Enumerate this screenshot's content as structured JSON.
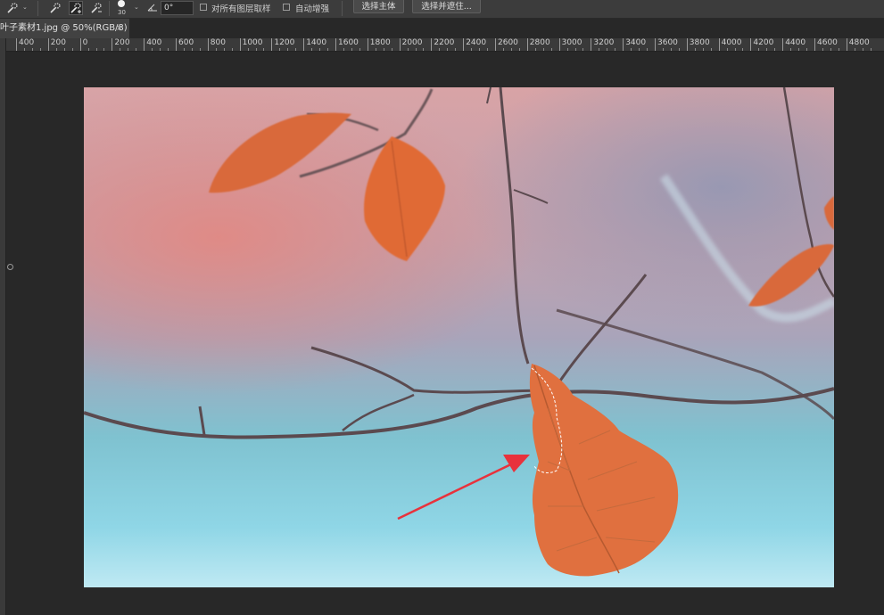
{
  "options_bar": {
    "brush_size": "30",
    "angle_value": "0°",
    "sample_all_layers_label": "对所有图层取样",
    "auto_enhance_label": "自动增强",
    "select_subject_label": "选择主体",
    "select_and_mask_label": "选择并遮住..."
  },
  "document_tab": {
    "title": "叶子素材1.jpg @ 50%(RGB/8)",
    "close": "×"
  },
  "ruler": {
    "labels": [
      "400",
      "200",
      "0",
      "200",
      "400",
      "600",
      "800",
      "1000",
      "1200",
      "1400",
      "1600",
      "1800",
      "2000",
      "2200",
      "2400",
      "2600",
      "2800",
      "3000",
      "3200",
      "3400",
      "3600",
      "3800",
      "4000",
      "4200",
      "4400",
      "4600",
      "4800"
    ]
  },
  "colors": {
    "annotation_arrow": "#e8323c",
    "leaf": "#e0703f",
    "branch": "#5a4a4a"
  }
}
